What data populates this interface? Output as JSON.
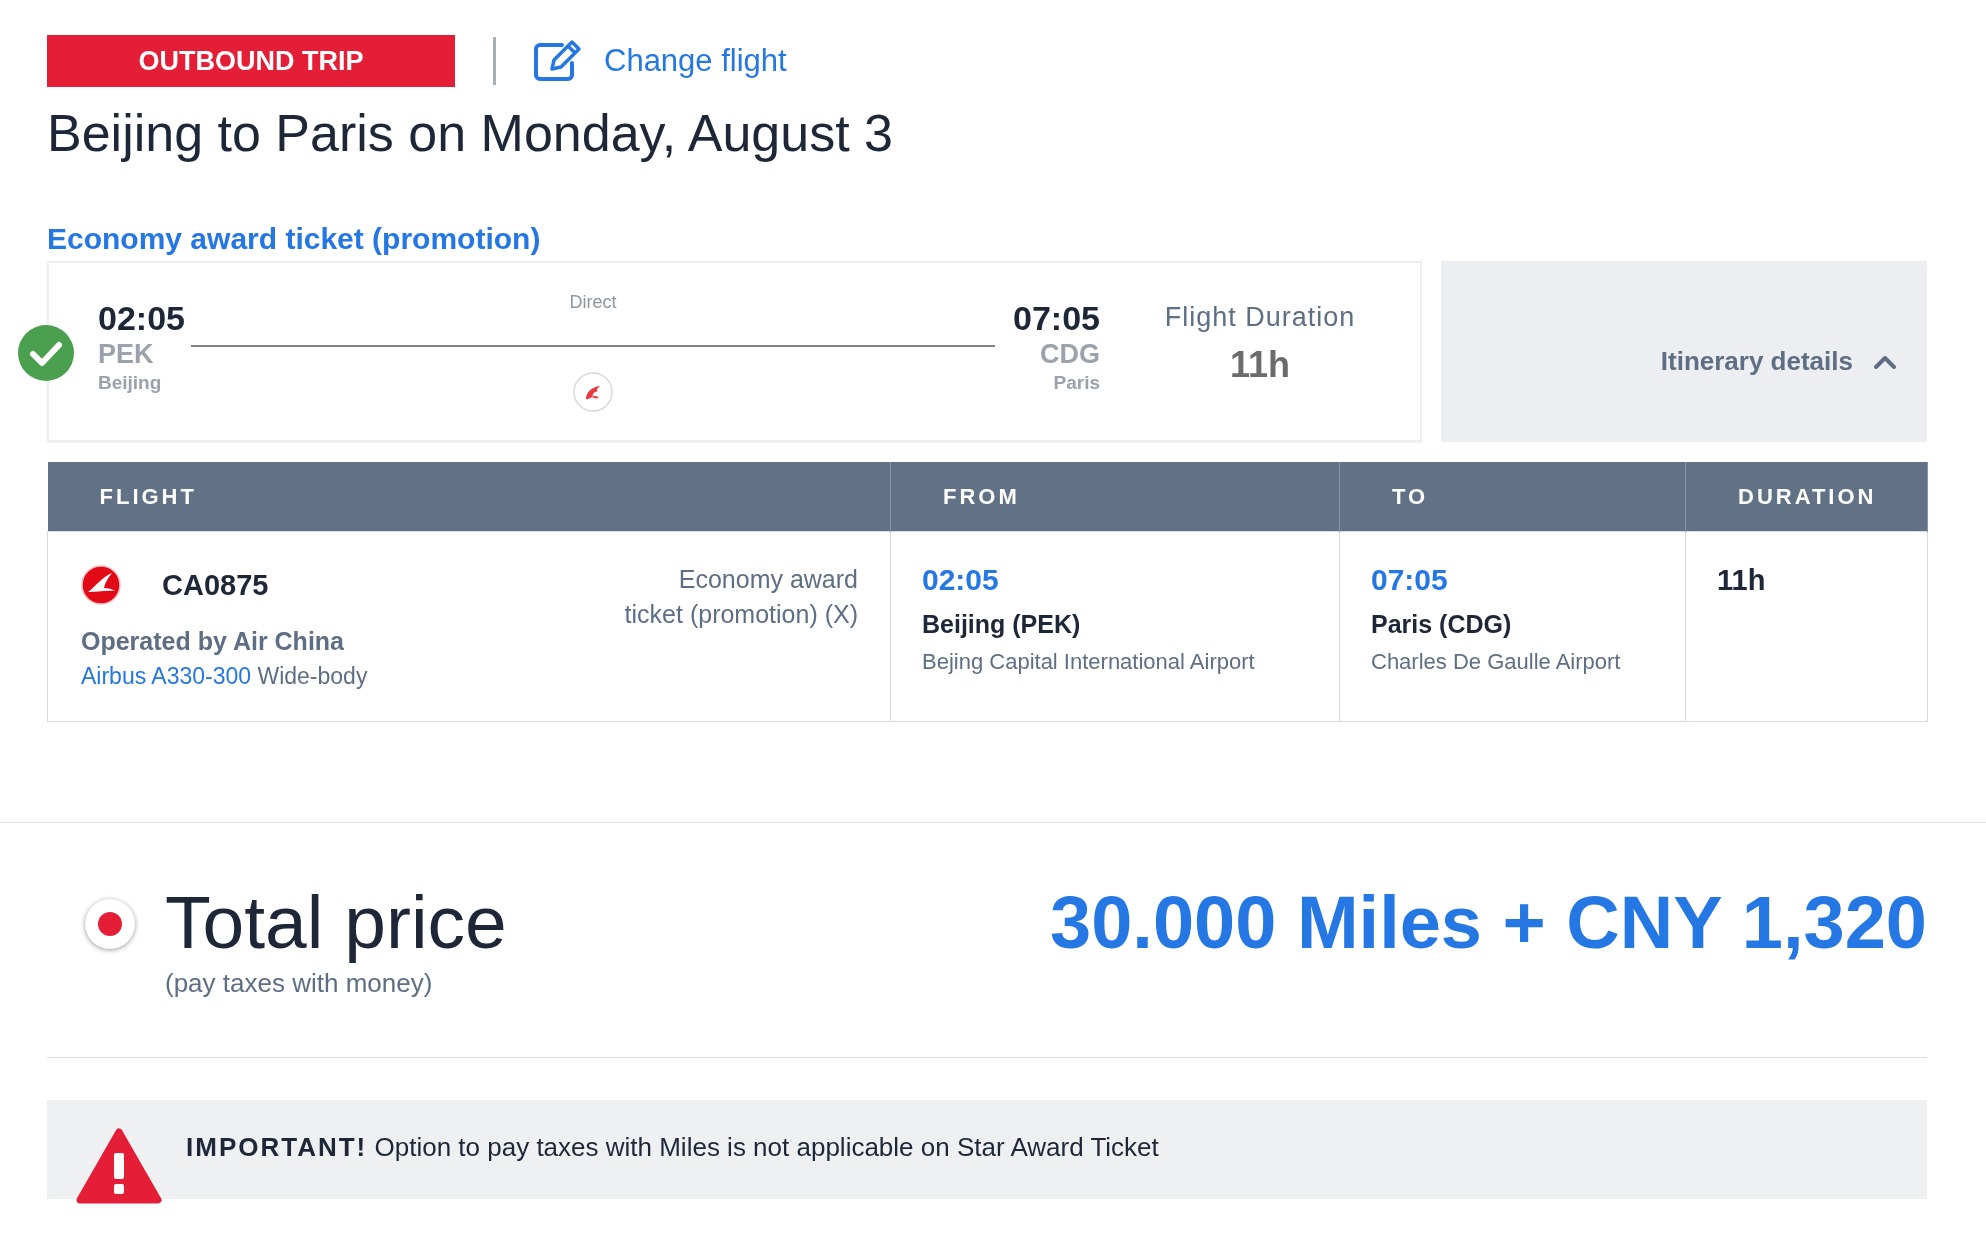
{
  "header": {
    "trip_badge": "OUTBOUND TRIP",
    "change_link": "Change flight",
    "title": "Beijing to Paris on Monday, August 3"
  },
  "fare_title": "Economy award ticket (promotion)",
  "summary": {
    "selected": true,
    "departure": {
      "time": "02:05",
      "code": "PEK",
      "city": "Beijing"
    },
    "stops": "Direct",
    "arrival": {
      "time": "07:05",
      "code": "CDG",
      "city": "Paris"
    },
    "duration_label": "Flight Duration",
    "duration": "11h"
  },
  "itinerary_toggle": {
    "label": "Itinerary details",
    "expanded": true
  },
  "table": {
    "columns": [
      "FLIGHT",
      "FROM",
      "TO",
      "DURATION"
    ],
    "rows": [
      {
        "flight_number": "CA0875",
        "operator": "Operated by Air China",
        "aircraft": "Airbus A330-300",
        "body_type": "Wide-body",
        "fare": "Economy award ticket (promotion) (X)",
        "from": {
          "time": "02:05",
          "place": "Beijing (PEK)",
          "airport": "Bejing Capital International Airport"
        },
        "to": {
          "time": "07:05",
          "place": "Paris (CDG)",
          "airport": "Charles De Gaulle Airport"
        },
        "duration": "11h"
      }
    ]
  },
  "price": {
    "selected": true,
    "label": "Total price",
    "note": "(pay taxes with money)",
    "amount": "30.000 Miles + CNY 1,320"
  },
  "notice": {
    "text": "**IMPORTANT!** Option to pay taxes with Miles is not applicable on Star Award Ticket"
  }
}
